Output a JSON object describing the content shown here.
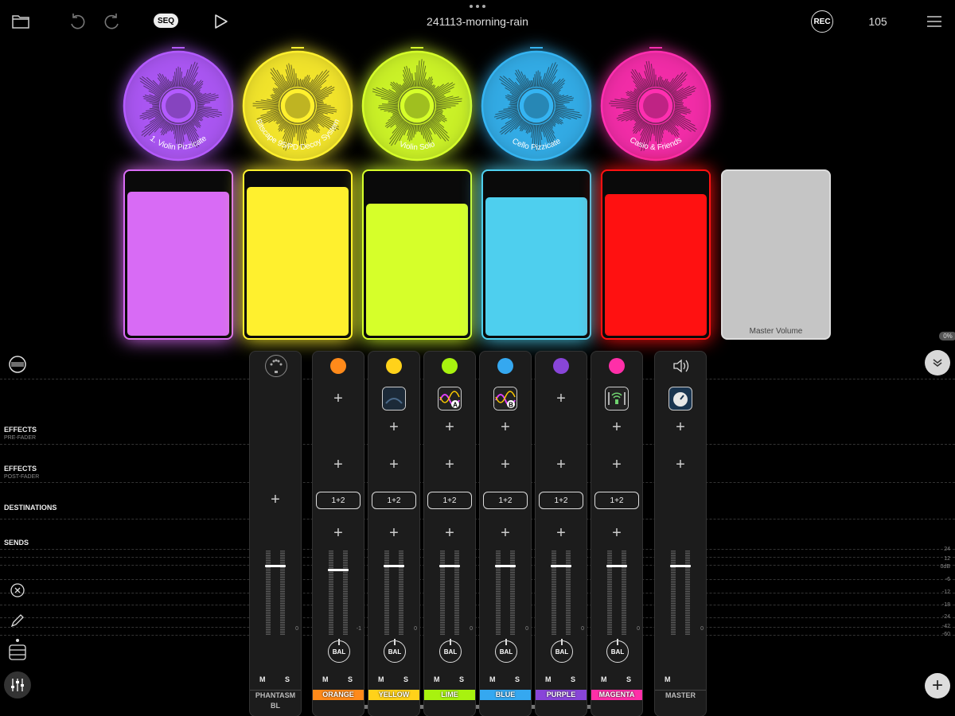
{
  "header": {
    "title": "241113-morning-rain",
    "seq_label": "SEQ",
    "rec_label": "REC",
    "tempo": "105"
  },
  "discs": [
    {
      "label": "1. Violin Pizzicate",
      "color": "#b35bff"
    },
    {
      "label": "Bitscape 95/PD Decoy System",
      "color": "#fff02e"
    },
    {
      "label": "Violin Solo",
      "color": "#d6ff2a"
    },
    {
      "label": "Cello Pizzicate",
      "color": "#35b4f2"
    },
    {
      "label": "Casio & Friends",
      "color": "#ff2fb0"
    }
  ],
  "pads": [
    {
      "color": "#d86bf5",
      "level": 0.86
    },
    {
      "color": "#fff02e",
      "level": 0.89
    },
    {
      "color": "#d6ff2a",
      "level": 0.79
    },
    {
      "color": "#4ecfee",
      "level": 0.83
    },
    {
      "color": "#ff1111",
      "level": 0.85
    }
  ],
  "master_pad": {
    "label": "Master Volume",
    "level_label": "0%"
  },
  "rows": {
    "effects_pre": "EFFECTS",
    "effects_pre_sub": "PRE-FADER",
    "effects_post": "EFFECTS",
    "effects_post_sub": "POST-FADER",
    "destinations": "DESTINATIONS",
    "sends": "SENDS"
  },
  "db_scale": [
    "24",
    "12",
    "0dB",
    "-6",
    "-12",
    "-18",
    "-24",
    "-42",
    "-60"
  ],
  "strips": [
    {
      "name": "PHANTASM BL",
      "color": null,
      "gain": "0",
      "mute": "M",
      "solo": "S"
    },
    {
      "name": "ORANGE",
      "color": "#ff8a1a",
      "gain": "-1",
      "dest": "1+2",
      "bal": "BAL",
      "mute": "M",
      "solo": "S"
    },
    {
      "name": "YELLOW",
      "color": "#ffd21a",
      "gain": "0",
      "dest": "1+2",
      "bal": "BAL",
      "mute": "M",
      "solo": "S"
    },
    {
      "name": "LIME",
      "color": "#a8f20f",
      "gain": "0",
      "dest": "1+2",
      "bal": "BAL",
      "mute": "M",
      "solo": "S"
    },
    {
      "name": "BLUE",
      "color": "#35a8f0",
      "gain": "0",
      "dest": "1+2",
      "bal": "BAL",
      "mute": "M",
      "solo": "S"
    },
    {
      "name": "PURPLE",
      "color": "#8845d8",
      "gain": "0",
      "dest": "1+2",
      "bal": "BAL",
      "mute": "M",
      "solo": "S"
    },
    {
      "name": "MAGENTA",
      "color": "#ff2fa8",
      "gain": "0",
      "dest": "1+2",
      "bal": "BAL",
      "mute": "M",
      "solo": "S"
    },
    {
      "name": "MASTER",
      "color": null,
      "gain": "0",
      "mute": "M"
    }
  ]
}
